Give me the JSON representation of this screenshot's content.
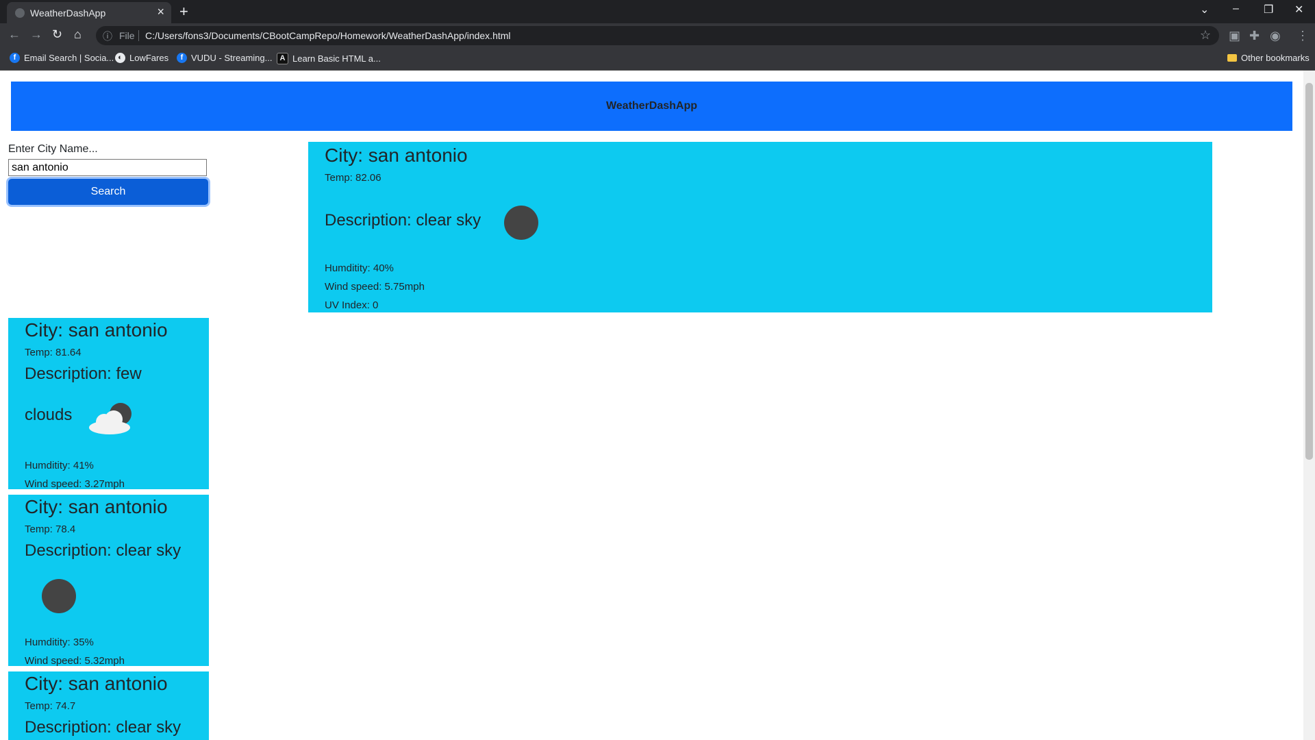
{
  "browser": {
    "tab_title": "WeatherDashApp",
    "url_scheme": "File",
    "url": "C:/Users/fons3/Documents/CBootCampRepo/Homework/WeatherDashApp/index.html",
    "bookmarks": [
      {
        "label": "Email Search | Socia...",
        "icon": "facebook-icon"
      },
      {
        "label": "LowFares",
        "icon": "globe-icon"
      },
      {
        "label": "VUDU - Streaming...",
        "icon": "facebook-icon"
      },
      {
        "label": "Learn Basic HTML a...",
        "icon": "site-icon"
      }
    ],
    "other_bookmarks": "Other bookmarks"
  },
  "app": {
    "header_title": "WeatherDashApp",
    "search": {
      "label": "Enter City Name...",
      "value": "san antonio",
      "button_label": "Search"
    },
    "current": {
      "city": "City: san antonio",
      "temp": "Temp: 82.06",
      "description": "Description: clear sky",
      "humidity": "Humditity: 40%",
      "wind": "Wind speed: 5.75mph",
      "uv": "UV Index: 0",
      "icon": "clear-sky-icon"
    },
    "forecast": [
      {
        "city": "City: san antonio",
        "temp": "Temp: 81.64",
        "description_line1": "Description: few",
        "description_line2": "clouds",
        "humidity": "Humditity: 41%",
        "wind": "Wind speed: 3.27mph",
        "icon": "few-clouds-icon"
      },
      {
        "city": "City: san antonio",
        "temp": "Temp: 78.4",
        "description": "Description: clear sky",
        "humidity": "Humditity: 35%",
        "wind": "Wind speed: 5.32mph",
        "icon": "clear-sky-icon"
      },
      {
        "city": "City: san antonio",
        "temp": "Temp: 74.7",
        "description": "Description: clear sky"
      }
    ]
  },
  "colors": {
    "header": "#0d6efd",
    "card": "#0dcaf0",
    "button": "#0b5ed7"
  }
}
